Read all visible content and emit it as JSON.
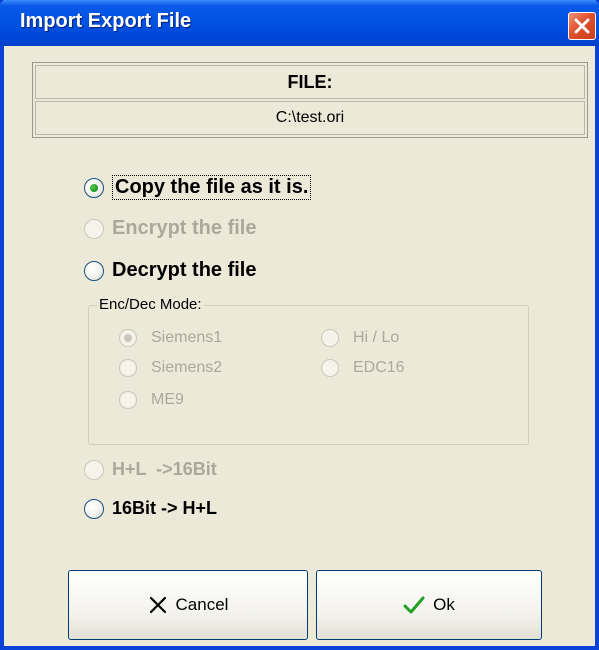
{
  "window": {
    "title": "Import Export File"
  },
  "file": {
    "heading": "FILE:",
    "path": "C:\\test.ori"
  },
  "options": {
    "copy": "Copy the file as it is.",
    "encrypt": "Encrypt the file",
    "decrypt": "Decrypt the file",
    "hl_to_16": "H+L  ->16Bit",
    "bit16_to_hl": "16Bit -> H+L"
  },
  "mode_group": {
    "label": "Enc/Dec Mode:",
    "siemens1": "Siemens1",
    "siemens2": "Siemens2",
    "me9": "ME9",
    "hilo": "Hi / Lo",
    "edc16": "EDC16"
  },
  "buttons": {
    "cancel": "Cancel",
    "ok": "Ok"
  },
  "colors": {
    "titlebar": "#0052E4",
    "close": "#E0512E",
    "check": "#21A121",
    "face": "#ECE9D8"
  }
}
